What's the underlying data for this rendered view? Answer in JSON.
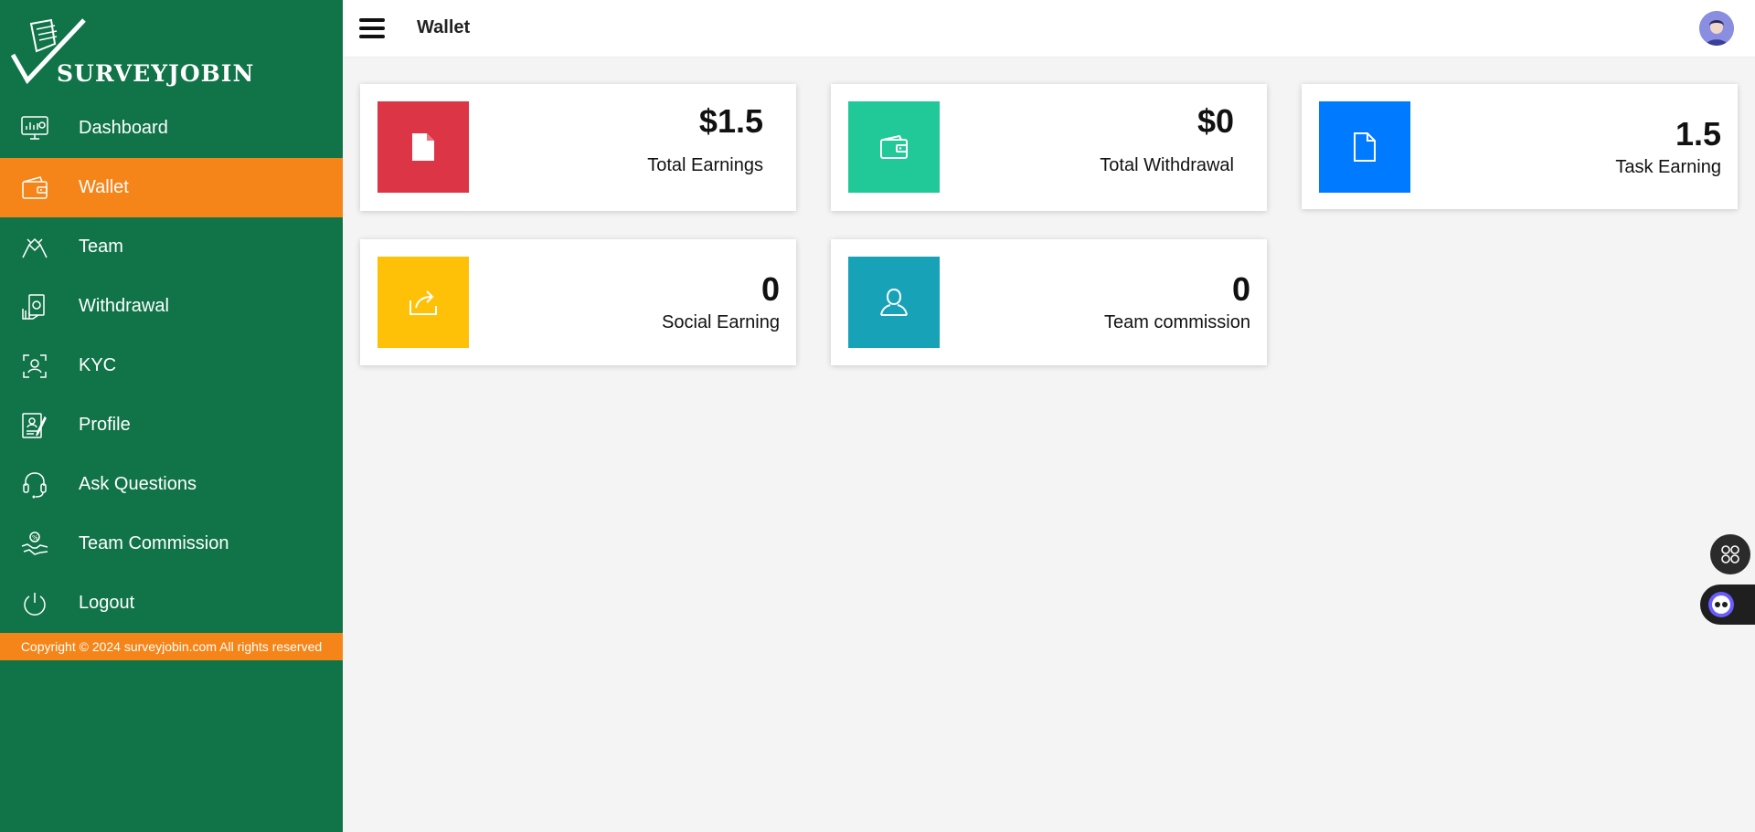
{
  "brand": {
    "name": "SURVEYJOBIN"
  },
  "sidebar": {
    "items": [
      {
        "label": "Dashboard",
        "icon": "dashboard-icon",
        "active": false
      },
      {
        "label": "Wallet",
        "icon": "wallet-icon",
        "active": true
      },
      {
        "label": "Team",
        "icon": "team-icon",
        "active": false
      },
      {
        "label": "Withdrawal",
        "icon": "withdrawal-icon",
        "active": false
      },
      {
        "label": "KYC",
        "icon": "kyc-icon",
        "active": false
      },
      {
        "label": "Profile",
        "icon": "profile-icon",
        "active": false
      },
      {
        "label": "Ask Questions",
        "icon": "headset-icon",
        "active": false
      },
      {
        "label": "Team Commission",
        "icon": "commission-icon",
        "active": false
      },
      {
        "label": "Logout",
        "icon": "power-icon",
        "active": false
      }
    ],
    "copyright": "Copyright © 2024 surveyjobin.com All rights reserved"
  },
  "header": {
    "title": "Wallet"
  },
  "cards": [
    {
      "value": "$1.5",
      "label": "Total Earnings",
      "color": "#dc3545",
      "icon": "document-icon"
    },
    {
      "value": "$0",
      "label": "Total Withdrawal",
      "color": "#20c997",
      "icon": "wallet-icon"
    },
    {
      "value": "1.5",
      "label": "Task Earning",
      "color": "#007bff",
      "icon": "file-icon"
    },
    {
      "value": "0",
      "label": "Social Earning",
      "color": "#ffc107",
      "icon": "share-icon"
    },
    {
      "value": "0",
      "label": "Team commission",
      "color": "#17a2b8",
      "icon": "user-icon"
    }
  ],
  "colors": {
    "sidebar": "#107448",
    "accent": "#f58518",
    "background": "#f4f4f4"
  }
}
